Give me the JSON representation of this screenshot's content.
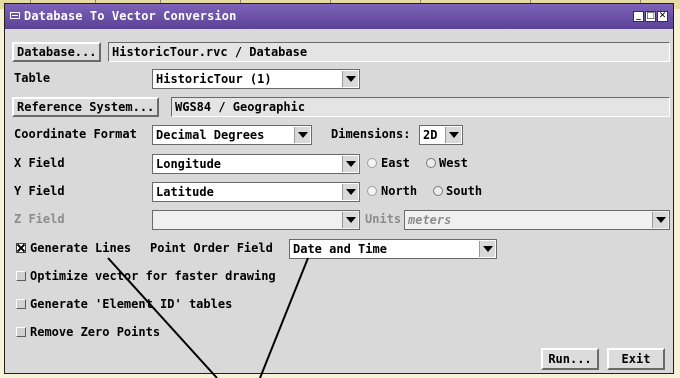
{
  "window": {
    "title": "Database To Vector Conversion",
    "buttons": [
      "_",
      "□",
      "✕"
    ]
  },
  "database": {
    "button_label": "Database...",
    "path": "HistoricTour.rvc / Database"
  },
  "table": {
    "label": "Table",
    "selected": "HistoricTour (1)"
  },
  "reference_system": {
    "button_label": "Reference System...",
    "value": "WGS84 / Geographic"
  },
  "coordinate_format": {
    "label": "Coordinate Format",
    "selected": "Decimal Degrees"
  },
  "dimensions": {
    "label": "Dimensions:",
    "selected": "2D"
  },
  "x_field": {
    "label": "X Field",
    "selected": "Longitude",
    "radio_a": "East",
    "radio_b": "West",
    "active": "East"
  },
  "y_field": {
    "label": "Y Field",
    "selected": "Latitude",
    "radio_a": "North",
    "radio_b": "South",
    "active": "North"
  },
  "z_field": {
    "label": "Z Field",
    "selected": "",
    "units_label": "Units",
    "units_value": "meters",
    "disabled": true
  },
  "options": {
    "generate_lines": {
      "label": "Generate Lines",
      "checked": true
    },
    "point_order_label": "Point Order Field",
    "point_order_selected": "Date and Time",
    "optimize": {
      "label": "Optimize vector for faster drawing",
      "checked": false
    },
    "element_id": {
      "label": "Generate 'Element ID' tables",
      "checked": false
    },
    "remove_zero": {
      "label": "Remove Zero Points",
      "checked": false
    }
  },
  "actions": {
    "run_label": "Run...",
    "exit_label": "Exit"
  },
  "colors": {
    "title_bar": "#6a50a8",
    "dialog_bg": "#d9d9d9",
    "background": "#f7f2d6"
  }
}
